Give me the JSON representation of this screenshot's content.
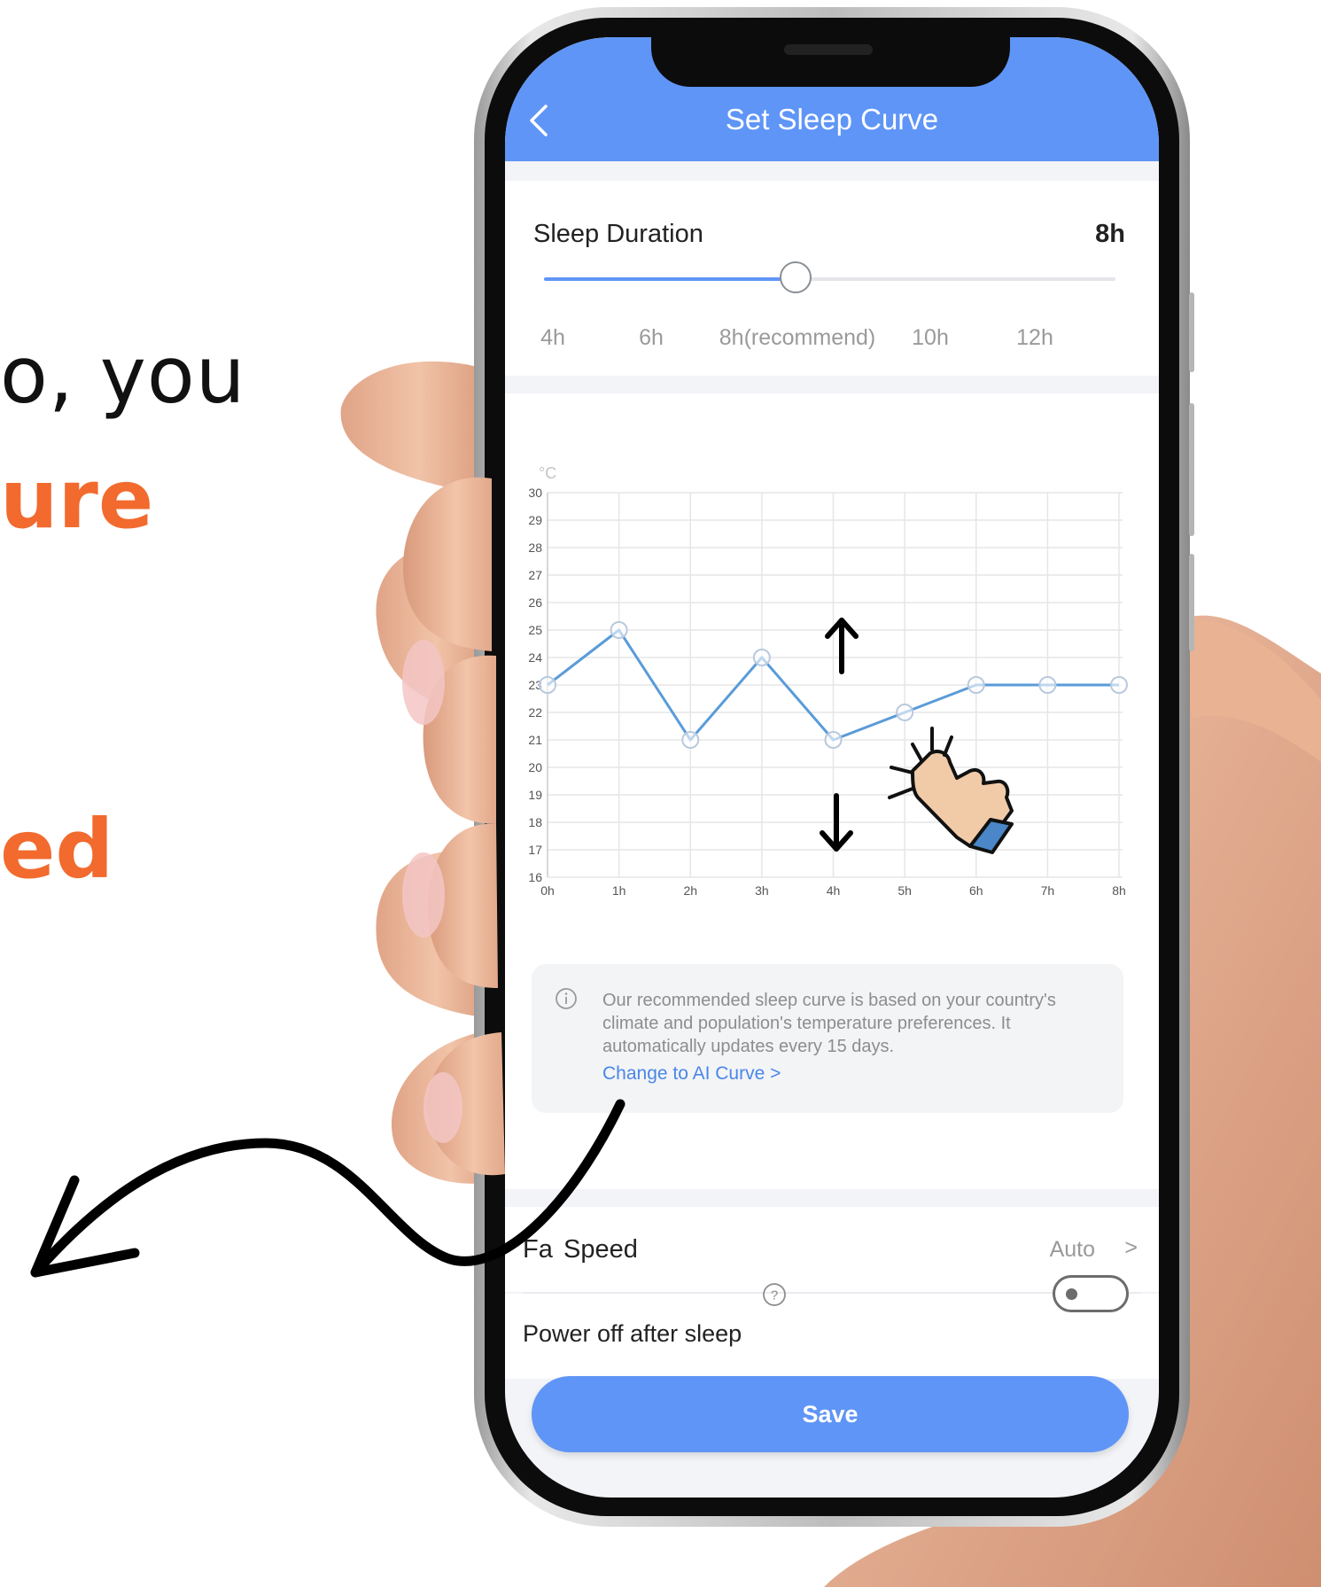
{
  "promo": {
    "line1": "o, you",
    "line2": "ure",
    "line3": "ed"
  },
  "header": {
    "title": "Set Sleep Curve",
    "back_icon": "chevron-left-icon"
  },
  "sleep_duration": {
    "label": "Sleep Duration",
    "value": "8h",
    "slider_value_hours": 8,
    "slider_min_hours": 4,
    "slider_max_hours": 12,
    "ticks": [
      "4h",
      "6h",
      "8h(recommend)",
      "10h",
      "12h"
    ]
  },
  "chart_data": {
    "type": "line",
    "unit_label": "°C",
    "x": [
      "0h",
      "1h",
      "2h",
      "3h",
      "4h",
      "5h",
      "6h",
      "7h",
      "8h"
    ],
    "y": [
      23,
      25,
      21,
      24,
      21,
      22,
      23,
      23,
      23
    ],
    "ylim": [
      16,
      30
    ],
    "yticks": [
      "16",
      "17",
      "18",
      "19",
      "20",
      "21",
      "22",
      "23",
      "24",
      "25",
      "26",
      "27",
      "28",
      "29",
      "30"
    ],
    "grid": true,
    "line_color": "#5a9bd8"
  },
  "info": {
    "text": "Our recommended sleep curve is based on your country's climate and population's temperature preferences. It automatically updates every 15 days.",
    "link": "Change to AI Curve >",
    "icon": "info-icon"
  },
  "fan_speed": {
    "label_prefix": "Fa",
    "label_suffix": "Speed",
    "value": "Auto",
    "chevron": ">"
  },
  "power_off": {
    "label": "Power off after sleep",
    "help_icon": "question-circle-icon",
    "enabled": false
  },
  "save_label": "Save",
  "colors": {
    "primary": "#5f95f6",
    "accent_orange": "#f26a2e",
    "link": "#4a86e8"
  },
  "overlay_icons": [
    "arrow-up-icon",
    "arrow-down-icon",
    "tapping-hand-icon",
    "curved-arrow-icon"
  ]
}
